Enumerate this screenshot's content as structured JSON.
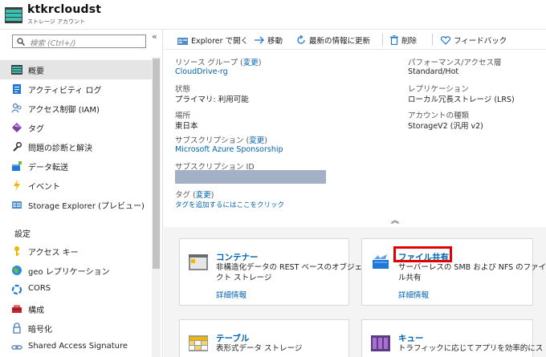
{
  "header": {
    "title": "ktkrcloudst",
    "subtitle": "ストレージ アカウント"
  },
  "search": {
    "placeholder": "検索 (Ctrl+/)"
  },
  "sidebar": {
    "items": [
      {
        "label": "概要",
        "icon": "overview-icon"
      },
      {
        "label": "アクティビティ ログ",
        "icon": "activity-log-icon"
      },
      {
        "label": "アクセス制御 (IAM)",
        "icon": "iam-icon"
      },
      {
        "label": "タグ",
        "icon": "tag-icon"
      },
      {
        "label": "問題の診断と解決",
        "icon": "wrench-icon"
      },
      {
        "label": "データ転送",
        "icon": "data-transfer-icon"
      },
      {
        "label": "イベント",
        "icon": "lightning-icon"
      },
      {
        "label": "Storage Explorer (プレビュー)",
        "icon": "storage-explorer-icon"
      }
    ],
    "settings_header": "設定",
    "settings_items": [
      {
        "label": "アクセス キー",
        "icon": "key-icon"
      },
      {
        "label": "geo レプリケーション",
        "icon": "globe-icon"
      },
      {
        "label": "CORS",
        "icon": "cors-icon"
      },
      {
        "label": "構成",
        "icon": "toolbox-icon"
      },
      {
        "label": "暗号化",
        "icon": "lock-icon"
      },
      {
        "label": "Shared Access Signature",
        "icon": "link-icon"
      }
    ]
  },
  "toolbar": {
    "open_explorer": "Explorer で開く",
    "move": "移動",
    "refresh": "最新の情報に更新",
    "delete": "削除",
    "feedback": "フィードバック"
  },
  "essentials": {
    "resource_group_label": "リソース グループ (",
    "change_label": "変更",
    "close_paren": ")",
    "resource_group_value": "CloudDrive-rg",
    "status_label": "状態",
    "status_value": "プライマリ: 利用可能",
    "location_label": "場所",
    "location_value": "東日本",
    "subscription_label": "サブスクリプション (",
    "subscription_value": "Microsoft Azure Sponsorship",
    "subscription_id_label": "サブスクリプション ID",
    "tags_label": "タグ (",
    "tags_add_link": "タグを追加するにはここをクリック",
    "performance_label": "パフォーマンス/アクセス層",
    "performance_value": "Standard/Hot",
    "replication_label": "レプリケーション",
    "replication_value": "ローカル冗長ストレージ (LRS)",
    "account_kind_label": "アカウントの種類",
    "account_kind_value": "StorageV2 (汎用 v2)"
  },
  "cards": {
    "containers": {
      "title": "コンテナー",
      "desc": "非構造化データの REST ベースのオブジェクト ストレージ",
      "link": "詳細情報"
    },
    "file_shares": {
      "title": "ファイル共有",
      "desc": "サーバーレスの SMB および NFS のファイル共有",
      "link": "詳細情報"
    },
    "tables": {
      "title": "テーブル",
      "desc": "表形式データ ストレージ"
    },
    "queues": {
      "title": "キュー",
      "desc": "トラフィックに応じてアプリを効率的にス"
    }
  },
  "colors": {
    "link": "#0063b1",
    "highlight": "#e00000",
    "active_nav": "#e5e5e5"
  }
}
